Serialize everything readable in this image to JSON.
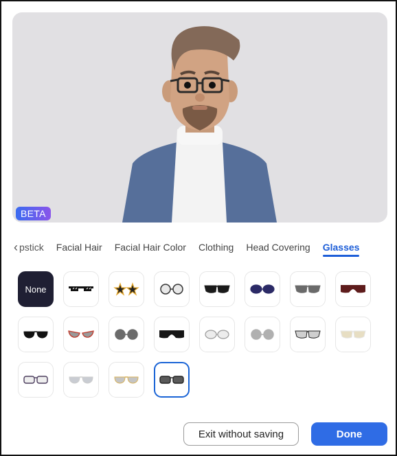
{
  "preview": {
    "badge": "BETA",
    "avatar_description": "avatar-with-glasses"
  },
  "tabs": {
    "back_label": "pstick",
    "items": [
      {
        "label": "Facial Hair",
        "active": false
      },
      {
        "label": "Facial Hair Color",
        "active": false
      },
      {
        "label": "Clothing",
        "active": false
      },
      {
        "label": "Head Covering",
        "active": false
      },
      {
        "label": "Glasses",
        "active": true
      }
    ]
  },
  "glasses_options": {
    "none_label": "None",
    "selected_index": 19,
    "items": [
      {
        "name": "none"
      },
      {
        "name": "pixel-thug-glasses",
        "color": "#111111"
      },
      {
        "name": "star-glasses",
        "color": "#222222",
        "frame": "#e2a52a"
      },
      {
        "name": "round-clear-glasses",
        "color": "#e8e8e8",
        "frame": "#333333"
      },
      {
        "name": "black-wayfarer-sunglasses",
        "color": "#1a1a1a"
      },
      {
        "name": "navy-oval-sunglasses",
        "color": "#2b2a66"
      },
      {
        "name": "gray-wayfarer-sunglasses",
        "color": "#6a6a6a"
      },
      {
        "name": "maroon-shield-sunglasses",
        "color": "#5e1c1c"
      },
      {
        "name": "aviator-black-sunglasses",
        "color": "#111111"
      },
      {
        "name": "red-cateye-sunglasses",
        "color": "#9a9a9a",
        "frame": "#c0392b"
      },
      {
        "name": "round-gray-sunglasses",
        "color": "#6b6b6b"
      },
      {
        "name": "black-shield-sunglasses",
        "color": "#151515"
      },
      {
        "name": "oval-clear-glasses",
        "color": "#ececec",
        "frame": "#999999"
      },
      {
        "name": "round-light-gray-sunglasses",
        "color": "#b0b0b0"
      },
      {
        "name": "browline-silver-sunglasses",
        "color": "#cfcfcf",
        "frame": "#222222"
      },
      {
        "name": "cream-wayfarer-sunglasses",
        "color": "#e7dec3",
        "frame": "#e5e5e5"
      },
      {
        "name": "purple-rectangular-glasses",
        "color": "#eeeeee",
        "frame": "#4a3b5c"
      },
      {
        "name": "silver-aviator-sunglasses",
        "color": "#c9ccd2",
        "frame": "#cccccc"
      },
      {
        "name": "gold-aviator-sunglasses",
        "color": "#c4c4c4",
        "frame": "#d8b25a"
      },
      {
        "name": "dark-rectangular-sunglasses",
        "color": "#5a5a5a",
        "frame": "#222222"
      }
    ]
  },
  "footer": {
    "exit_label": "Exit without saving",
    "done_label": "Done"
  },
  "colors": {
    "accent": "#1d5ed8",
    "done_button": "#2f6ce5",
    "none_tile": "#1f1f33"
  }
}
